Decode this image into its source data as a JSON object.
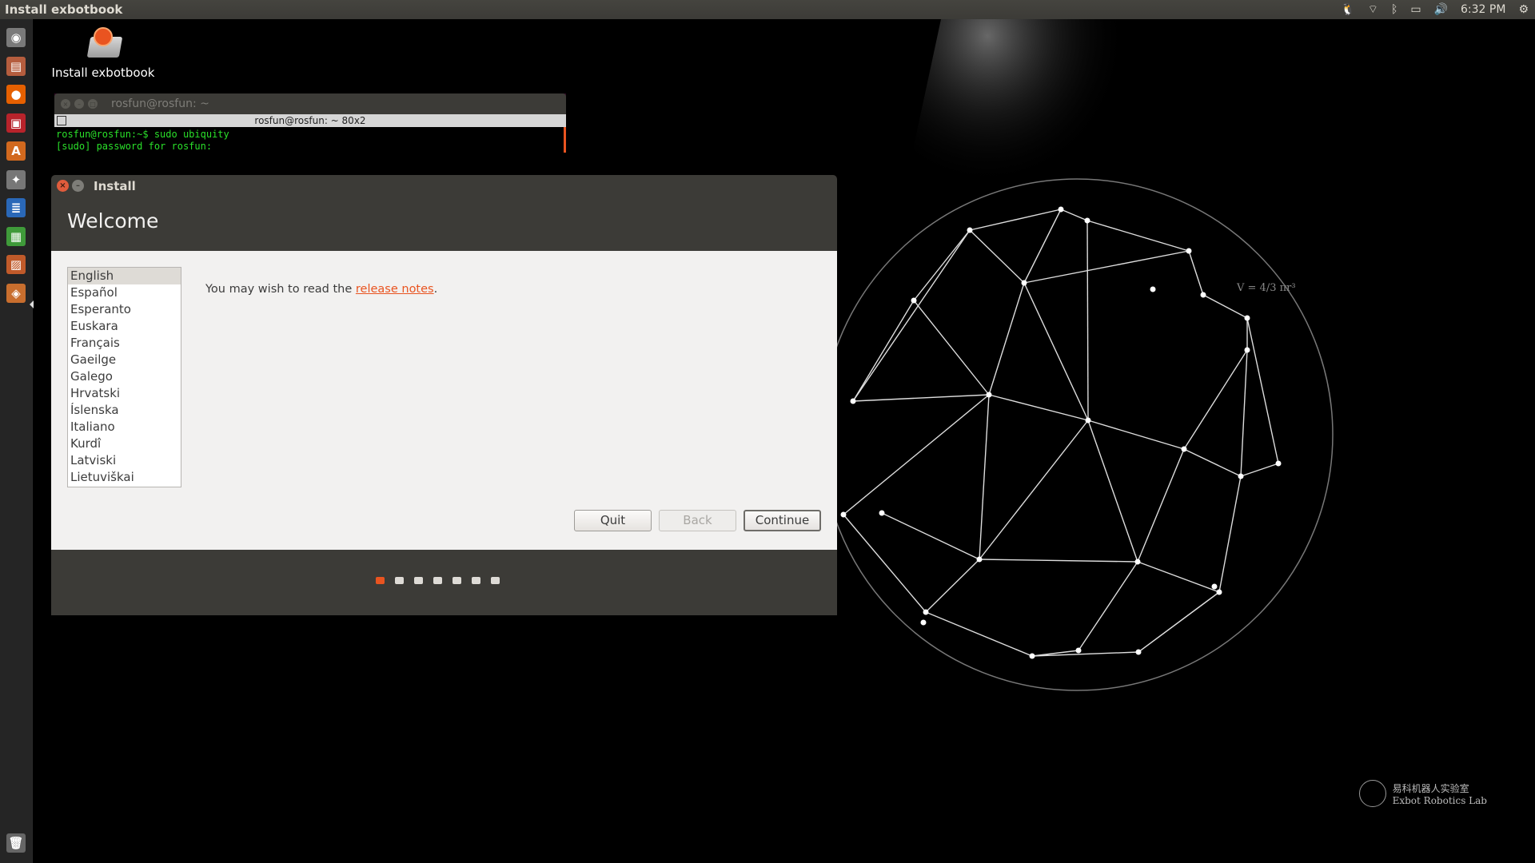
{
  "top_panel": {
    "title": "Install exbotbook",
    "clock": "6:32 PM",
    "indicators": [
      "linux-tux-icon",
      "wifi-icon",
      "bluetooth-icon",
      "battery-icon",
      "volume-icon",
      "gear-icon"
    ]
  },
  "launcher": {
    "items": [
      {
        "name": "dash-home",
        "color": "#7a7a7a",
        "glyph": "◉"
      },
      {
        "name": "files",
        "color": "#b55d3e",
        "glyph": "▤"
      },
      {
        "name": "firefox",
        "color": "#e66000",
        "glyph": "●"
      },
      {
        "name": "presentation",
        "color": "#b8232b",
        "glyph": "▣"
      },
      {
        "name": "software-center",
        "color": "#d2691e",
        "glyph": "A"
      },
      {
        "name": "system-settings",
        "color": "#777",
        "glyph": "✦"
      },
      {
        "name": "writer",
        "color": "#2a68b8",
        "glyph": "≣"
      },
      {
        "name": "calc",
        "color": "#3f9a3a",
        "glyph": "▦"
      },
      {
        "name": "impress",
        "color": "#c05a2a",
        "glyph": "▨"
      },
      {
        "name": "installer",
        "color": "#c86e2e",
        "glyph": "◈"
      }
    ],
    "trash": "trash-icon"
  },
  "desktop": {
    "icon_label": "Install exbotbook"
  },
  "terminal": {
    "title": "rosfun@rosfun: ~",
    "size_label": "rosfun@rosfun: ~ 80x2",
    "lines": [
      "rosfun@rosfun:~$ sudo ubiquity",
      "[sudo] password for rosfun:"
    ]
  },
  "installer": {
    "title": "Install",
    "heading": "Welcome",
    "languages": [
      "English",
      "Español",
      "Esperanto",
      "Euskara",
      "Français",
      "Gaeilge",
      "Galego",
      "Hrvatski",
      "Íslenska",
      "Italiano",
      "Kurdî",
      "Latviski",
      "Lietuviškai"
    ],
    "selected_language": "English",
    "intro_prefix": "You may wish to read the ",
    "intro_link": "release notes",
    "intro_suffix": ".",
    "buttons": {
      "quit": "Quit",
      "back": "Back",
      "continue": "Continue"
    },
    "steps_total": 7,
    "current_step": 1
  },
  "wallpaper": {
    "formula": "V = 4/3 πr³",
    "lab_name_cn": "易科机器人实验室",
    "lab_name_en": "Exbot Robotics Lab",
    "accent": "#e95420"
  }
}
